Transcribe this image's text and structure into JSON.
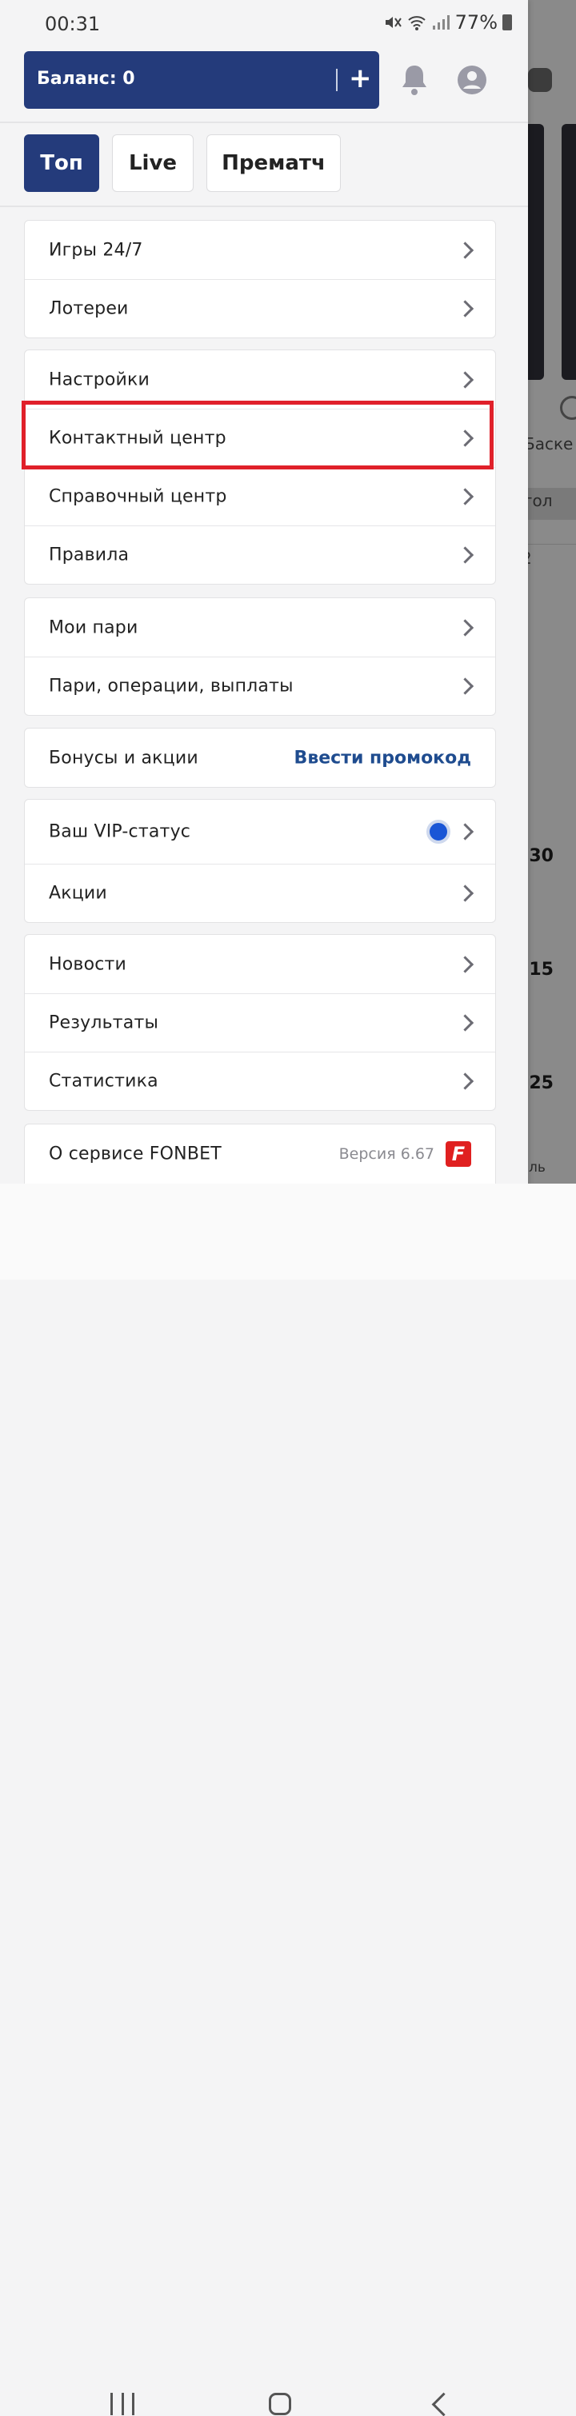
{
  "status_bar": {
    "time": "00:31",
    "battery": "77%"
  },
  "header": {
    "balance_label": "Баланс: 0",
    "balance_plus": "+"
  },
  "tabs": [
    {
      "label": "Топ",
      "active": true
    },
    {
      "label": "Live",
      "active": false
    },
    {
      "label": "Прематч",
      "active": false
    }
  ],
  "menu": {
    "group1": [
      {
        "label": "Игры 24/7"
      },
      {
        "label": "Лотереи"
      }
    ],
    "group2": [
      {
        "label": "Настройки"
      },
      {
        "label": "Контактный центр"
      },
      {
        "label": "Справочный центр"
      },
      {
        "label": "Правила"
      }
    ],
    "group3": [
      {
        "label": "Мои пари"
      },
      {
        "label": "Пари, операции, выплаты"
      }
    ],
    "bonuses": {
      "label": "Бонусы и акции",
      "link": "Ввести промокод"
    },
    "group5": [
      {
        "label": "Ваш VIP-статус"
      },
      {
        "label": "Акции"
      }
    ],
    "group6": [
      {
        "label": "Новости"
      },
      {
        "label": "Результаты"
      },
      {
        "label": "Статистика"
      }
    ],
    "about": {
      "label": "О сервисе FONBET",
      "version": "Версия 6.67",
      "logo": "F"
    }
  },
  "background": {
    "sport_label": "Баске",
    "col_label": "гол",
    "col_value": "2",
    "odds": [
      ".30",
      ".15",
      ".25"
    ],
    "bottom_label": "иль"
  },
  "colors": {
    "brand": "#243b7b",
    "highlight": "#e0202a",
    "link": "#1f4c8f",
    "vip_dot": "#1a56d6"
  }
}
